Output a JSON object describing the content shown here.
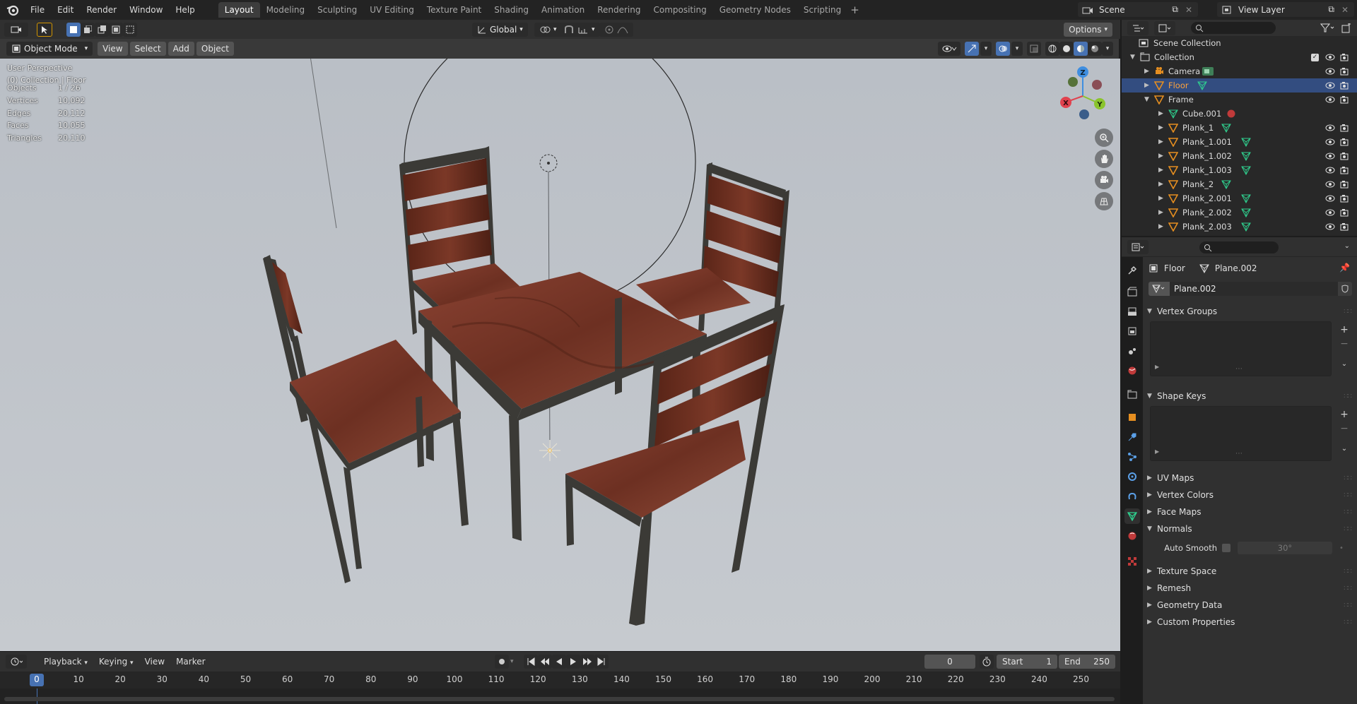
{
  "menubar": {
    "items": [
      "File",
      "Edit",
      "Render",
      "Window",
      "Help"
    ],
    "workspaces": [
      "Layout",
      "Modeling",
      "Sculpting",
      "UV Editing",
      "Texture Paint",
      "Shading",
      "Animation",
      "Rendering",
      "Compositing",
      "Geometry Nodes",
      "Scripting"
    ],
    "active_workspace": "Layout",
    "add_workspace_icon": "plus-icon",
    "scene": "Scene",
    "view_layer": "View Layer"
  },
  "viewport": {
    "mode": "Object Mode",
    "menus": [
      "View",
      "Select",
      "Add",
      "Object"
    ],
    "transform_orientation": "Global",
    "options_label": "Options",
    "perspective": "User Perspective",
    "context": "(0) Collection | Floor",
    "stats": [
      {
        "label": "Objects",
        "value": "1 / 26"
      },
      {
        "label": "Vertices",
        "value": "10,092"
      },
      {
        "label": "Edges",
        "value": "20,112"
      },
      {
        "label": "Faces",
        "value": "10,055"
      },
      {
        "label": "Triangles",
        "value": "20,110"
      }
    ],
    "gizmo": {
      "x": "X",
      "y": "Y",
      "z": "Z"
    },
    "colors": {
      "background": "#393939",
      "wood": "#7a3b2a",
      "frame": "#3a3a36",
      "axis_x": "#e0424e",
      "axis_y": "#8ac42c",
      "axis_z": "#3f8ee0"
    }
  },
  "timeline": {
    "menus": [
      "Playback",
      "Keying",
      "View",
      "Marker"
    ],
    "current_frame": "0",
    "start_label": "Start",
    "start_value": "1",
    "end_label": "End",
    "end_value": "250",
    "ruler": [
      "0",
      "10",
      "20",
      "30",
      "40",
      "50",
      "60",
      "70",
      "80",
      "90",
      "100",
      "110",
      "120",
      "130",
      "140",
      "150",
      "160",
      "170",
      "180",
      "190",
      "200",
      "210",
      "220",
      "230",
      "240",
      "250"
    ]
  },
  "outliner": {
    "root": "Scene Collection",
    "rows": [
      {
        "name": "Collection",
        "type": "collection",
        "depth": 1,
        "expanded": true
      },
      {
        "name": "Camera",
        "type": "camera",
        "depth": 2,
        "expanded": false
      },
      {
        "name": "Floor",
        "type": "mesh",
        "depth": 2,
        "expanded": false,
        "selected": true
      },
      {
        "name": "Frame",
        "type": "mesh",
        "depth": 2,
        "expanded": true
      },
      {
        "name": "Cube.001",
        "type": "mesh-data",
        "depth": 3,
        "expanded": false
      },
      {
        "name": "Plank_1",
        "type": "mesh",
        "depth": 3,
        "expanded": false
      },
      {
        "name": "Plank_1.001",
        "type": "mesh",
        "depth": 3,
        "expanded": false
      },
      {
        "name": "Plank_1.002",
        "type": "mesh",
        "depth": 3,
        "expanded": false
      },
      {
        "name": "Plank_1.003",
        "type": "mesh",
        "depth": 3,
        "expanded": false
      },
      {
        "name": "Plank_2",
        "type": "mesh",
        "depth": 3,
        "expanded": false
      },
      {
        "name": "Plank_2.001",
        "type": "mesh",
        "depth": 3,
        "expanded": false
      },
      {
        "name": "Plank_2.002",
        "type": "mesh",
        "depth": 3,
        "expanded": false
      },
      {
        "name": "Plank_2.003",
        "type": "mesh",
        "depth": 3,
        "expanded": false
      }
    ]
  },
  "properties": {
    "object_name": "Floor",
    "mesh_name": "Plane.002",
    "datablock": "Plane.002",
    "panels": {
      "vertex_groups": "Vertex Groups",
      "shape_keys": "Shape Keys",
      "uv_maps": "UV Maps",
      "vertex_colors": "Vertex Colors",
      "face_maps": "Face Maps",
      "normals": "Normals",
      "auto_smooth": "Auto Smooth",
      "auto_smooth_angle": "30°",
      "texture_space": "Texture Space",
      "remesh": "Remesh",
      "geometry_data": "Geometry Data",
      "custom_properties": "Custom Properties"
    }
  }
}
